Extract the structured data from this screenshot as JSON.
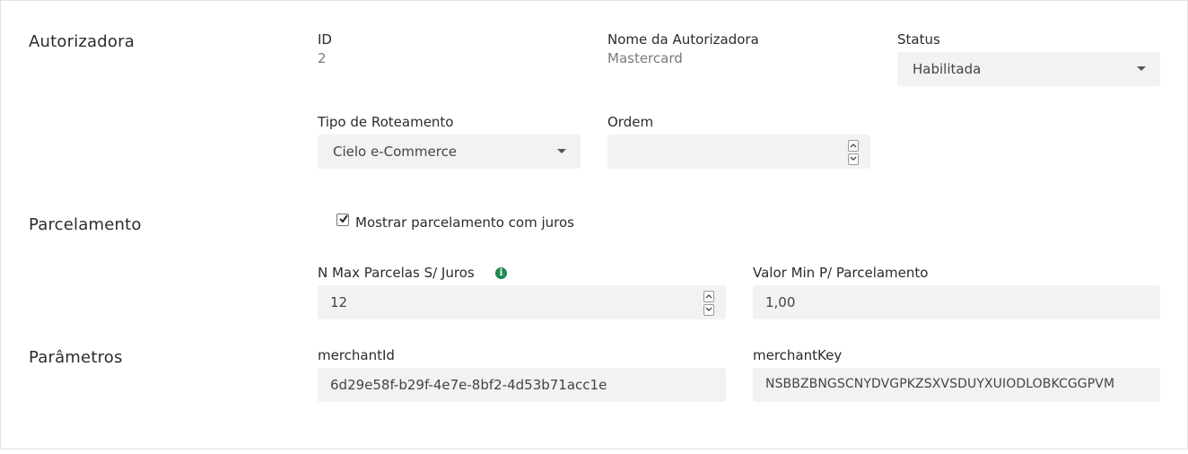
{
  "sections": {
    "autorizadora": "Autorizadora",
    "parcelamento": "Parcelamento",
    "parametros": "Parâmetros"
  },
  "autorizadora": {
    "id_label": "ID",
    "id_value": "2",
    "nome_label": "Nome da Autorizadora",
    "nome_value": "Mastercard",
    "status_label": "Status",
    "status_value": "Habilitada",
    "tipo_label": "Tipo de Roteamento",
    "tipo_value": "Cielo e-Commerce",
    "ordem_label": "Ordem",
    "ordem_value": ""
  },
  "parcelamento": {
    "checkbox_label": "Mostrar parcelamento com juros",
    "checkbox_checked": true,
    "nmax_label": "N Max Parcelas S/ Juros",
    "nmax_value": "12",
    "info_icon": "info-icon",
    "valor_min_label": "Valor Min P/ Parcelamento",
    "valor_min_value": "1,00"
  },
  "parametros": {
    "merchant_id_label": "merchantId",
    "merchant_id_value": "6d29e58f-b29f-4e7e-8bf2-4d53b71acc1e",
    "merchant_key_label": "merchantKey",
    "merchant_key_value": "NSBBZBNGSCNYDVGPKZSXVSDUYXUIODLOBKCGGPVM"
  },
  "colors": {
    "field_bg": "#f2f2f2",
    "info_icon": "#1e8a4c",
    "muted_text": "#7a7a7a"
  }
}
